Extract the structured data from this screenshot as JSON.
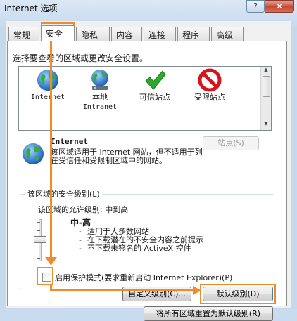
{
  "window": {
    "title": "Internet 选项",
    "help_label": "?",
    "close_label": "✕"
  },
  "tabs": [
    {
      "label": "常规"
    },
    {
      "label": "安全",
      "active": true
    },
    {
      "label": "隐私"
    },
    {
      "label": "内容"
    },
    {
      "label": "连接"
    },
    {
      "label": "程序"
    },
    {
      "label": "高级"
    }
  ],
  "zones": {
    "prompt": "选择要查看的区域或更改安全设置。",
    "items": [
      {
        "label": "Internet",
        "icon": "globe-icon"
      },
      {
        "label": "本地",
        "sublabel": "Intranet",
        "icon": "intranet-icon"
      },
      {
        "label": "可信站点",
        "icon": "checkmark-icon"
      },
      {
        "label": "受限站点",
        "icon": "restricted-icon"
      }
    ]
  },
  "selected_zone": {
    "name": "Internet",
    "sites_button": "站点(S)",
    "description": "该区域适用于 Internet 网站，但不适用于列在受信任和受限制区域中的网站。"
  },
  "security_level": {
    "legend": "该区域的安全级别(L)",
    "allowed": "该区域的允许级别: 中到高",
    "level_name": "中-高",
    "bullets": [
      "适用于大多数网站",
      "在下载潜在的不安全内容之前提示",
      "不下载未签名的 ActiveX 控件"
    ]
  },
  "protected_mode": {
    "label": "启用保护模式(要求重新启动 Internet Explorer)(P)",
    "checked": false
  },
  "buttons": {
    "custom": "自定义级别(C)...",
    "default": "默认级别(D)",
    "reset_all": "将所有区域重置为默认级别(R)"
  },
  "colors": {
    "highlight": "#f08a2a",
    "title_bg": "#c6d9ec",
    "close_red": "#c24b33"
  }
}
